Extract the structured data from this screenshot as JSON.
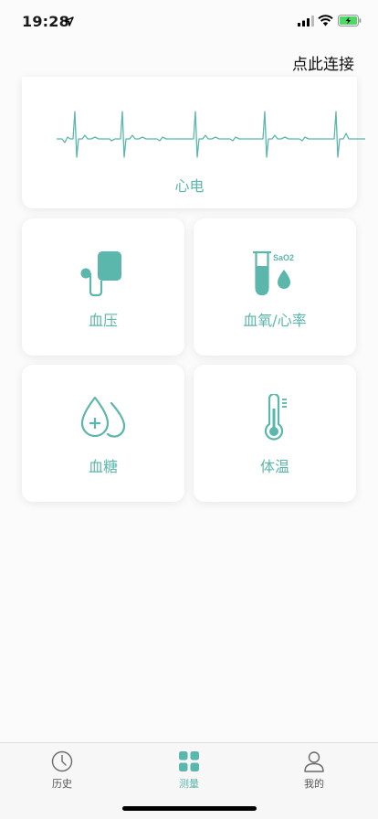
{
  "status_bar": {
    "time": "19:28",
    "icons": [
      "location-arrow-icon",
      "signal-icon",
      "wifi-icon",
      "battery-charging-icon"
    ]
  },
  "header": {
    "connect_label": "点此连接"
  },
  "cards": {
    "ecg": {
      "label": "心电",
      "icon": "ecg-wave-icon"
    },
    "blood_pressure": {
      "label": "血压",
      "icon": "blood-pressure-cuff-icon"
    },
    "spo2": {
      "label": "血氧/心率",
      "icon": "test-tube-drop-icon",
      "icon_text": "SaO2"
    },
    "glucose": {
      "label": "血糖",
      "icon": "blood-drop-plus-icon"
    },
    "temperature": {
      "label": "体温",
      "icon": "thermometer-icon"
    }
  },
  "tab_bar": {
    "tabs": [
      {
        "label": "历史",
        "icon": "clock-icon",
        "active": false
      },
      {
        "label": "测量",
        "icon": "grid-icon",
        "active": true
      },
      {
        "label": "我的",
        "icon": "person-icon",
        "active": false
      }
    ]
  },
  "colors": {
    "accent": "#5bb6ab",
    "background": "#fbfbfb",
    "card": "#ffffff",
    "battery": "#4cd964"
  }
}
